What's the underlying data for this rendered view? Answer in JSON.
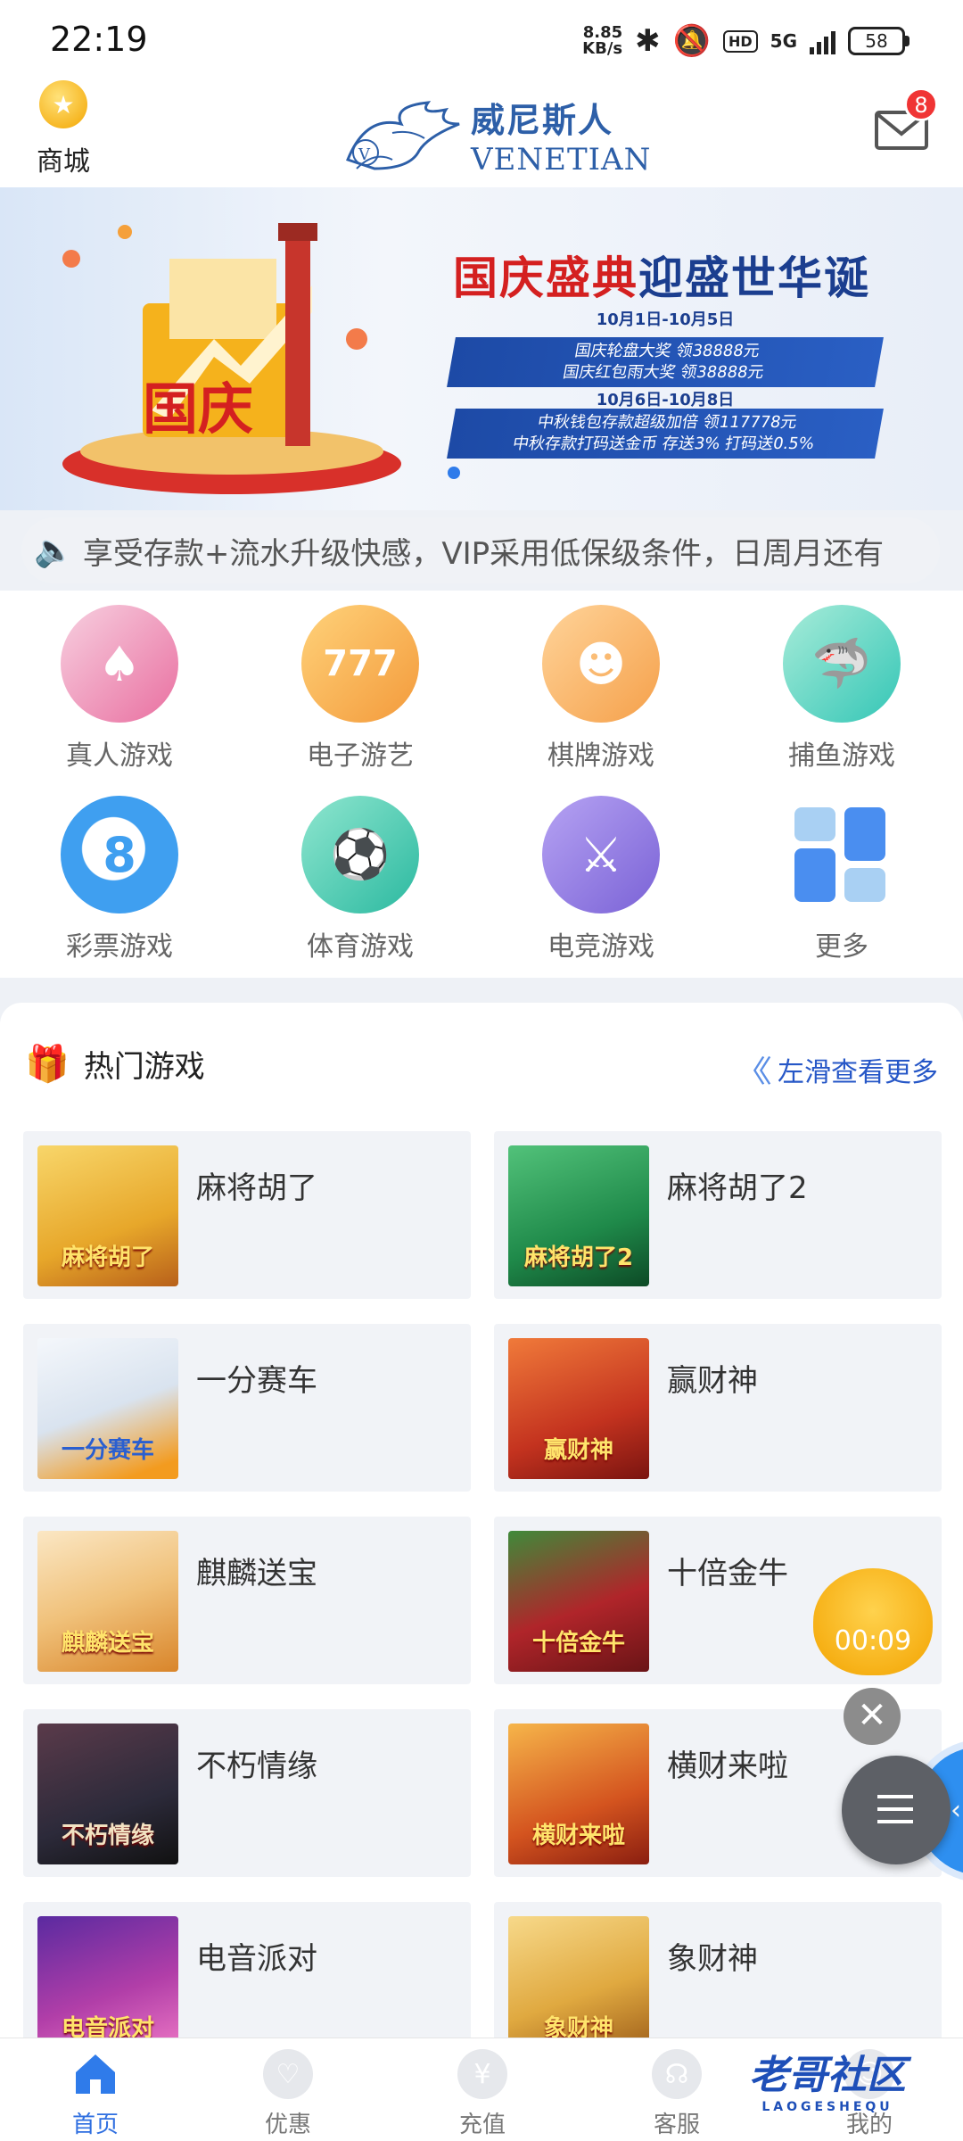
{
  "status_bar": {
    "time": "22:19",
    "net_speed_value": "8.85",
    "net_speed_unit": "KB/s",
    "hd": "HD",
    "network": "5G",
    "battery": "58"
  },
  "header": {
    "mall_label": "商城",
    "logo_cn": "威尼斯人",
    "logo_en": "VENETIAN",
    "mail_badge": "8"
  },
  "banner": {
    "art_text": "国庆",
    "headline_red": "国庆盛典",
    "headline_blue": "迎盛世华诞",
    "sub1": "10月1日-10月5日",
    "panel1_line1": "国庆轮盘大奖  领38888元",
    "panel1_line2": "国庆红包雨大奖  领38888元",
    "sub2": "10月6日-10月8日",
    "panel2_line1": "中秋钱包存款超级加倍  领117778元",
    "panel2_line2": "中秋存款打码送金币  存送3%  打码送0.5%"
  },
  "marquee": {
    "text": "享受存款+流水升级快感，VIP采用低保级条件，日周月还有"
  },
  "categories": [
    {
      "label": "真人游戏",
      "icon": "cards-icon",
      "color": "#e96fa0"
    },
    {
      "label": "电子游艺",
      "icon": "slot-777-icon",
      "color": "#f39a3b"
    },
    {
      "label": "棋牌游戏",
      "icon": "chess-character-icon",
      "color": "#f5a04a"
    },
    {
      "label": "捕鱼游戏",
      "icon": "shark-icon",
      "color": "#34c6b6"
    },
    {
      "label": "彩票游戏",
      "icon": "lottery-ball-icon",
      "color": "#3f9ff0"
    },
    {
      "label": "体育游戏",
      "icon": "football-player-icon",
      "color": "#2bb9a0"
    },
    {
      "label": "电竞游戏",
      "icon": "esports-hero-icon",
      "color": "#7a62d6"
    },
    {
      "label": "更多",
      "icon": "grid-more-icon",
      "color": "#4a8ef0"
    }
  ],
  "hot": {
    "title": "热门游戏",
    "more": "左滑查看更多",
    "games": [
      {
        "name": "麻将胡了",
        "thumb_text": "麻将胡了",
        "color": "#e7a72a"
      },
      {
        "name": "麻将胡了2",
        "thumb_text": "麻将胡了2",
        "color": "#1f8a4a"
      },
      {
        "name": "一分赛车",
        "thumb_text": "一分赛车",
        "color": "#d9e3ef"
      },
      {
        "name": "赢财神",
        "thumb_text": "赢财神",
        "color": "#c4331f"
      },
      {
        "name": "麒麟送宝",
        "thumb_text": "麒麟送宝",
        "color": "#f0c17a"
      },
      {
        "name": "十倍金牛",
        "thumb_text": "十倍金牛",
        "color": "#b0252a"
      },
      {
        "name": "不朽情缘",
        "thumb_text": "不朽情缘",
        "color": "#2c2a3a"
      },
      {
        "name": "横财来啦",
        "thumb_text": "横财来啦",
        "color": "#d4541f"
      },
      {
        "name": "电音派对",
        "thumb_text": "电音派对",
        "color": "#b13ea8"
      },
      {
        "name": "象财神",
        "thumb_text": "象财神",
        "color": "#e0a940"
      }
    ]
  },
  "float": {
    "timer": "00:09"
  },
  "tabbar": {
    "items": [
      "首页",
      "优惠",
      "充值",
      "客服",
      "我的"
    ]
  },
  "watermark": {
    "main": "老哥社区",
    "sub": "LAOGESHEQU"
  }
}
